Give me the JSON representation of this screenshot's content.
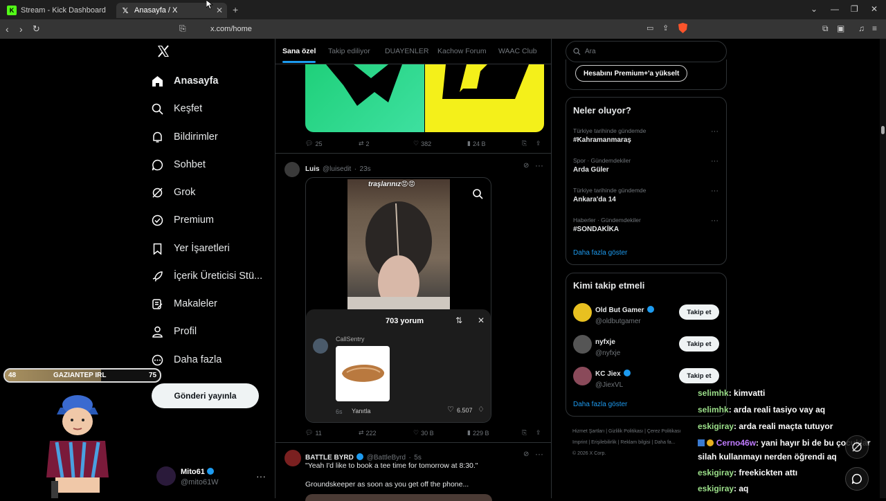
{
  "browser": {
    "tabs": [
      {
        "title": "Stream - Kick Dashboard",
        "icon": "kick-icon"
      },
      {
        "title": "Anasayfa / X",
        "icon": "x-logo-icon"
      }
    ],
    "url": "x.com/home"
  },
  "sidebar": {
    "items": [
      {
        "label": "Anasayfa",
        "icon": "home-icon"
      },
      {
        "label": "Keşfet",
        "icon": "search-icon"
      },
      {
        "label": "Bildirimler",
        "icon": "bell-icon"
      },
      {
        "label": "Sohbet",
        "icon": "chat-icon"
      },
      {
        "label": "Grok",
        "icon": "grok-icon"
      },
      {
        "label": "Premium",
        "icon": "premium-icon"
      },
      {
        "label": "Yer İşaretleri",
        "icon": "bookmark-icon"
      },
      {
        "label": "İçerik Üreticisi Stü...",
        "icon": "rocket-icon"
      },
      {
        "label": "Makaleler",
        "icon": "article-icon"
      },
      {
        "label": "Profil",
        "icon": "person-icon"
      },
      {
        "label": "Daha fazla",
        "icon": "more-circle-icon"
      }
    ],
    "post_button": "Gönderi yayınla",
    "account": {
      "name": "Mito61",
      "handle": "@mito61W"
    }
  },
  "feed": {
    "tabs": [
      "Sana özel",
      "Takip ediliyor",
      "DUAYENLER",
      "Kachow Forum",
      "WAAC Club"
    ],
    "post1": {
      "replies": "25",
      "reposts": "2",
      "likes": "382",
      "views": "24 B"
    },
    "post2": {
      "name": "Luis",
      "handle": "@luisedit",
      "time": "23s",
      "media_caption": "traşlarınız😡😡",
      "replies": "11",
      "reposts": "222",
      "likes": "30 B",
      "views": "229 B",
      "comments_panel": {
        "title": "703 yorum",
        "commenter": "CallSentry",
        "comment_age": "6s",
        "reply_label": "Yanıtla",
        "likes": "6.507"
      }
    },
    "post3": {
      "name": "BATTLE BYRD",
      "handle": "@BattleByrd",
      "time": "5s",
      "text1": "\"Yeah I'd like to book a tee time for tomorrow at 8:30.\"",
      "text2": "Groundskeeper as soon as you get off the phone..."
    }
  },
  "right": {
    "search_placeholder": "Ara",
    "premium_button": "Hesabını Premium+'a yükselt",
    "trends_title": "Neler oluyor?",
    "trends": [
      {
        "category": "Türkiye tarihinde gündemde",
        "title": "#Kahramanmaraş"
      },
      {
        "category": "Spor · Gündemdekiler",
        "title": "Arda Güler"
      },
      {
        "category": "Türkiye tarihinde gündemde",
        "title": "Ankara'da 14"
      },
      {
        "category": "Haberler · Gündemdekiler",
        "title": "#SONDAKİKA"
      }
    ],
    "trends_more": "Daha fazla göster",
    "follow_title": "Kimi takip etmeli",
    "follow": [
      {
        "name": "Old But Gamer",
        "handle": "@oldbutgamer",
        "button": "Takip et"
      },
      {
        "name": "nyfxje",
        "handle": "@nyfxje",
        "button": "Takip et"
      },
      {
        "name": "KC Jiex",
        "handle": "@JiexVL",
        "button": "Takip et"
      }
    ],
    "follow_more": "Daha fazla göster",
    "footer": [
      "Hizmet Şartları",
      "Gizlilik Politikası",
      "Çerez Politikası",
      "Imprint",
      "Erişilebilirlik",
      "Reklam bilgisi",
      "Daha fa...",
      "© 2026 X Corp."
    ]
  },
  "overlay": {
    "match_bar": {
      "left_value": "48",
      "label": "GAZIANTEP IRL",
      "right_value": "75"
    },
    "chat": [
      {
        "user": "selimhk",
        "message": ": kimvatti"
      },
      {
        "user": "selimhk",
        "message": ": arda reali tasiyo vay aq"
      },
      {
        "user": "eskigiray",
        "message": ": arda reali maçta tutuyor"
      },
      {
        "user": "Cerno46w",
        "message": ": yani hayır bi de bu çocuklar"
      },
      {
        "user": "",
        "message": "silah kullanmayı nerden öğrendi aq"
      },
      {
        "user": "eskigiray",
        "message": ": freekickten attı"
      },
      {
        "user": "eskigiray",
        "message": ": aq"
      }
    ]
  },
  "colors": {
    "accent": "#1d9bf0",
    "verified": "#1d9bf0",
    "chat_user": "#9ce08a",
    "chat_user_purple": "#c07cff"
  }
}
